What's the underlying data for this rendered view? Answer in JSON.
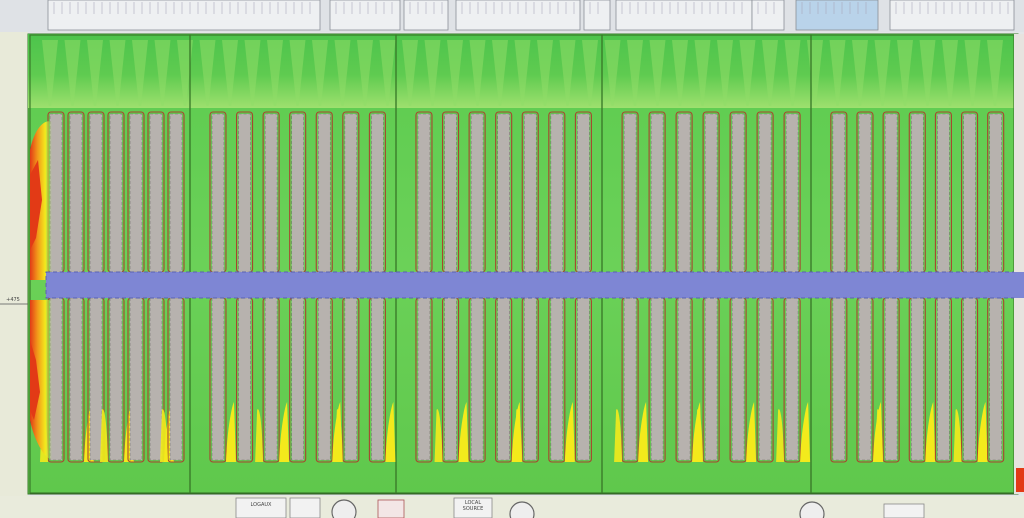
{
  "map": {
    "title": "",
    "left_marker": "+475",
    "bottom_labels": [
      {
        "text": "LOGAUX"
      },
      {
        "text": "LOCAL SOURCE"
      }
    ]
  },
  "heatmap": {
    "colors": {
      "green_dark": "#4cc44c",
      "green_mid": "#67cf56",
      "green_light": "#9fe070",
      "yellow": "#f3ea1c",
      "orange": "#f29a1a",
      "red": "#e23a16",
      "rack_gray": "#b7b2ae",
      "aisle_blue": "#7e86d4",
      "contour": "#a8452f",
      "outline": "#3a7a2a"
    },
    "module_count": 5,
    "racks_per_module": 7,
    "aisle_rows": [
      "central-cross-aisle"
    ]
  }
}
